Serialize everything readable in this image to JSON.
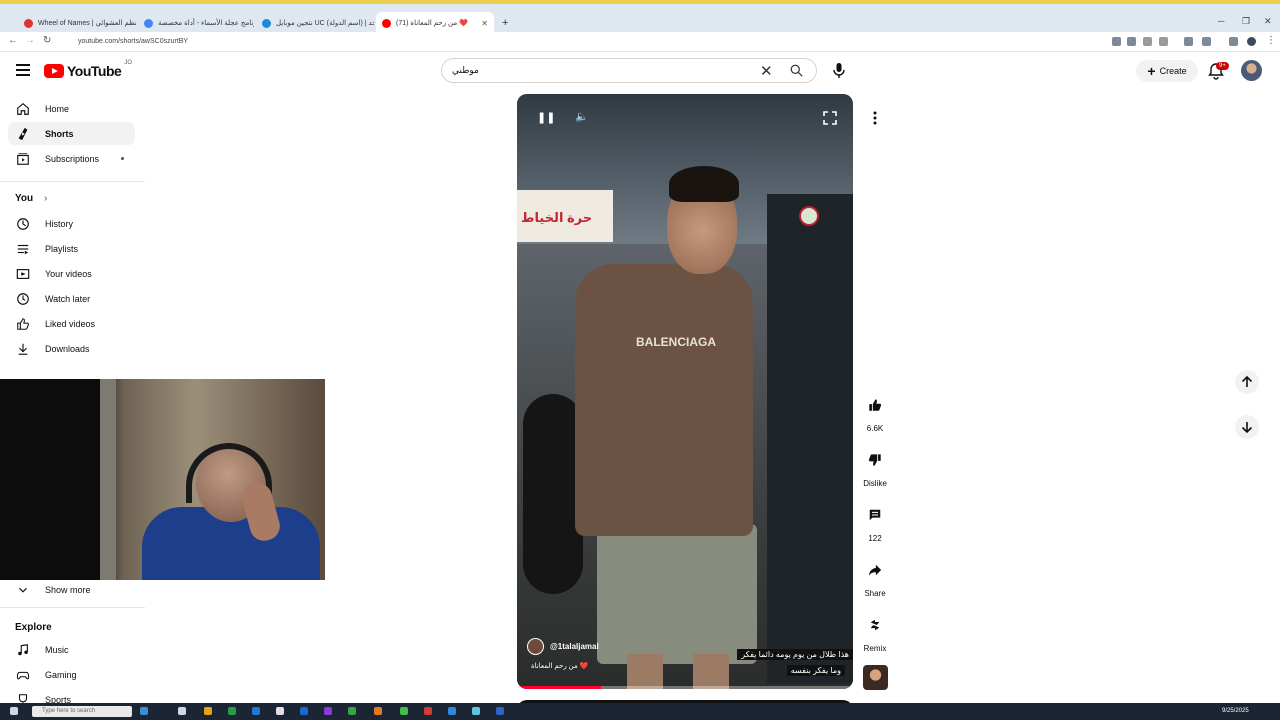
{
  "browser": {
    "tabs": [
      {
        "title": "Wheel of Names | نظم العشوائي",
        "color": "#d33"
      },
      {
        "title": "برنامج عجلة الأسماء - أداة مخصصة",
        "color": "#4285f4"
      },
      {
        "title": "نتجين موبايل UC (اسم الدولة) | خد",
        "color": "#1a8dd6"
      },
      {
        "title": "(71) من رحم المعاناة ❤️",
        "color": "#ff0000"
      }
    ],
    "url": "youtube.com/shorts/awSC0szurtBY"
  },
  "header": {
    "logo_text": "YouTube",
    "country_code": "JO",
    "search_value": "موطني",
    "create_label": "Create",
    "notification_count": "9+"
  },
  "sidebar": {
    "main": [
      {
        "label": "Home",
        "icon": "home-icon"
      },
      {
        "label": "Shorts",
        "icon": "shorts-icon"
      },
      {
        "label": "Subscriptions",
        "icon": "subscriptions-icon"
      }
    ],
    "you_heading": "You",
    "you": [
      {
        "label": "History",
        "icon": "history-icon"
      },
      {
        "label": "Playlists",
        "icon": "playlists-icon"
      },
      {
        "label": "Your videos",
        "icon": "your-videos-icon"
      },
      {
        "label": "Watch later",
        "icon": "clock-icon"
      },
      {
        "label": "Liked videos",
        "icon": "thumbs-up-icon"
      },
      {
        "label": "Downloads",
        "icon": "download-icon"
      }
    ],
    "show_more": "Show more",
    "explore_heading": "Explore",
    "explore": [
      {
        "label": "Music",
        "icon": "music-icon"
      },
      {
        "label": "Gaming",
        "icon": "gaming-icon"
      },
      {
        "label": "Sports",
        "icon": "trophy-icon"
      }
    ]
  },
  "video": {
    "sign_text": "حرة الخياط",
    "shirt_text": "BALENCIAGA",
    "channel": "@1talaljamal",
    "caption": "من رحم المعاناة ❤️",
    "subtitle_line1": "هذا طلال من يوم يومه دائما يفكر",
    "subtitle_line2": "وما يفكر بنفسه",
    "progress": 0.25
  },
  "actions": {
    "likes": "6.6K",
    "dislike": "Dislike",
    "comments": "122",
    "share": "Share",
    "remix": "Remix"
  },
  "taskbar": {
    "search_placeholder": "Type here to search",
    "date": "9/25/2025"
  }
}
